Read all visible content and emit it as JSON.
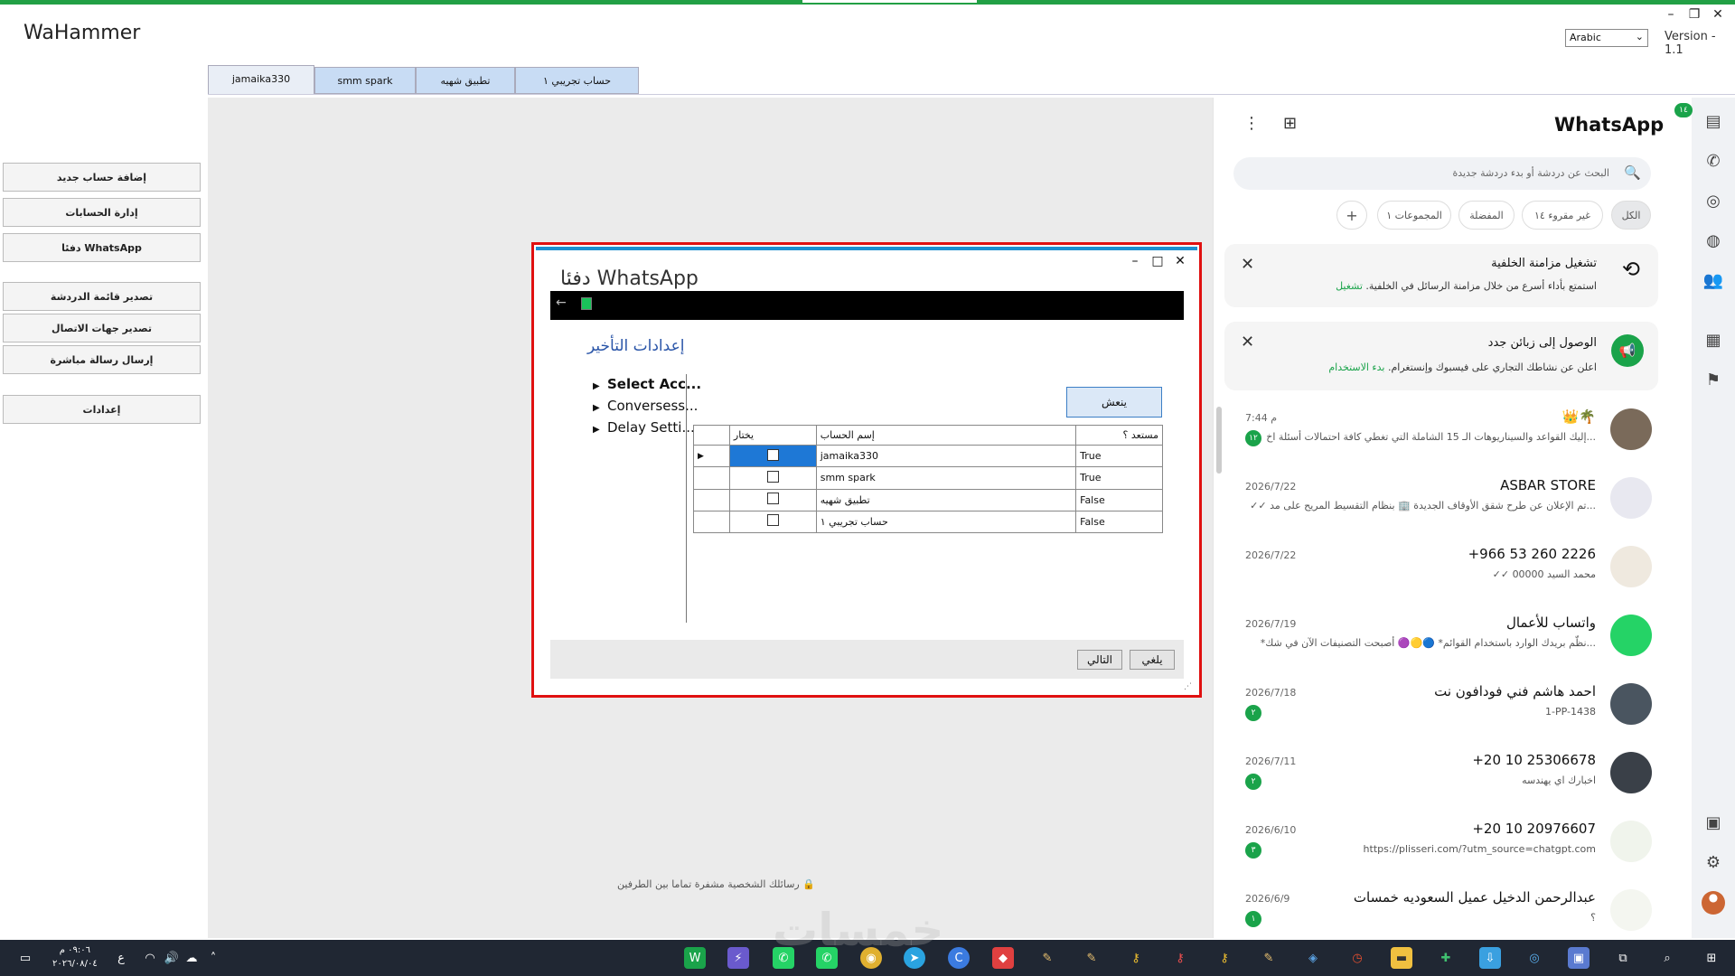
{
  "app": {
    "title": "WaHammer",
    "language": "Arabic",
    "version": "Version - 1.1"
  },
  "tabs": [
    {
      "label": "jamaika330",
      "active": true
    },
    {
      "label": "smm spark",
      "active": false
    },
    {
      "label": "تطبيق شهيه",
      "active": false
    },
    {
      "label": "حساب تجريبي ١",
      "active": false
    }
  ],
  "left_menu": [
    "إضافة حساب جديد",
    "إدارة الحسابات",
    "دفئا WhatsApp",
    "تصدير قائمة الدردشة",
    "تصدير جهات الاتصال",
    "إرسال رسالة مباشرة",
    "إعدادات"
  ],
  "encryption_note": "رسائلك الشخصية مشفرة تماما بين الطرفين",
  "dialog": {
    "title": "دفئا WhatsApp",
    "section_title": "إعدادات التأخير",
    "tree": [
      "Select Acc...",
      "Conversess...",
      "Delay Setti..."
    ],
    "refresh_label": "ينعش",
    "columns": {
      "select": "يختار",
      "account": "إسم الحساب",
      "ready": "مستعد ؟"
    },
    "rows": [
      {
        "account": "jamaika330",
        "ready": "True",
        "current": true
      },
      {
        "account": "smm spark",
        "ready": "True",
        "current": false
      },
      {
        "account": "تطبيق شهيه",
        "ready": "False",
        "current": false
      },
      {
        "account": "حساب تجريبي ١",
        "ready": "False",
        "current": false
      }
    ],
    "next_label": "التالي",
    "cancel_label": "يلغي"
  },
  "whatsapp": {
    "title": "WhatsApp",
    "search_placeholder": "البحث عن دردشة أو بدء دردشة جديدة",
    "filters": {
      "all": "الكل",
      "unread": "غير مقروء ١٤",
      "favorites": "المفضلة",
      "groups": "المجموعات ١"
    },
    "rail_badge": "١٤",
    "cards": [
      {
        "title": "تشغيل مزامنة الخلفية",
        "text": "استمتع بأداء أسرع من خلال مزامنة الرسائل في الخلفية.",
        "action": "تشغيل"
      },
      {
        "title": "الوصول إلى زبائن جدد",
        "text": "اعلن عن نشاطك التجاري على فيسبوك وإنستغرام.",
        "action": "بدء الاستخدام"
      }
    ],
    "chats": [
      {
        "name": "👑🌴",
        "msg": "إليك القواعد والسيناريوهات الـ 15 الشاملة التي تغطي كافة احتمالات أسئلة اخ...",
        "time": "7:44 م",
        "badge": "١٢",
        "avatar_color": "#7a6a5a"
      },
      {
        "name": "ASBAR STORE",
        "msg": "✓✓ تم الإعلان عن طرح شقق الأوقاف الجديدة 🏢 بنظام التقسيط المريح على مد...",
        "time": "2026/7/22",
        "badge": "",
        "avatar_color": "#e8e8f0"
      },
      {
        "name": "+966 53 260 2226",
        "msg": "✓✓ محمد السيد 00000",
        "time": "2026/7/22",
        "badge": "",
        "avatar_color": "#efe9df"
      },
      {
        "name": "واتساب للأعمال",
        "msg": "*نظّم بريدك الوارد باستخدام القوائم* 🔵🟡🟣 أصبحت التصنيفات الآن في شك...",
        "time": "2026/7/19",
        "badge": "",
        "avatar_color": "#25d366"
      },
      {
        "name": "احمد هاشم فني فودافون نت",
        "msg": "1-PP-1438",
        "time": "2026/7/18",
        "badge": "٢",
        "avatar_color": "#4a5560"
      },
      {
        "name": "+20 10 25306678",
        "msg": "اخبارك اي يهندسه",
        "time": "2026/7/11",
        "badge": "٢",
        "avatar_color": "#3a4048"
      },
      {
        "name": "+20 10 20976607",
        "msg": "https://plisseri.com/?utm_source=chatgpt.com",
        "time": "2026/6/10",
        "badge": "٣",
        "avatar_color": "#f0f4ec"
      },
      {
        "name": "عبدالرحمن الدخيل عميل السعوديه خمسات",
        "msg": "؟",
        "time": "2026/6/9",
        "badge": "١",
        "avatar_color": "#f4f6f0"
      }
    ]
  },
  "taskbar": {
    "time": "٠٩:٠٦ م",
    "date": "٢٠٢٦/٠٨/٠٤",
    "lang": "ع"
  },
  "watermark": "خمسات",
  "colors": {
    "accent_green": "#1aa34a",
    "dialog_border": "#e01010",
    "tab_blue": "#c8dcf4",
    "taskbar": "#202733"
  }
}
